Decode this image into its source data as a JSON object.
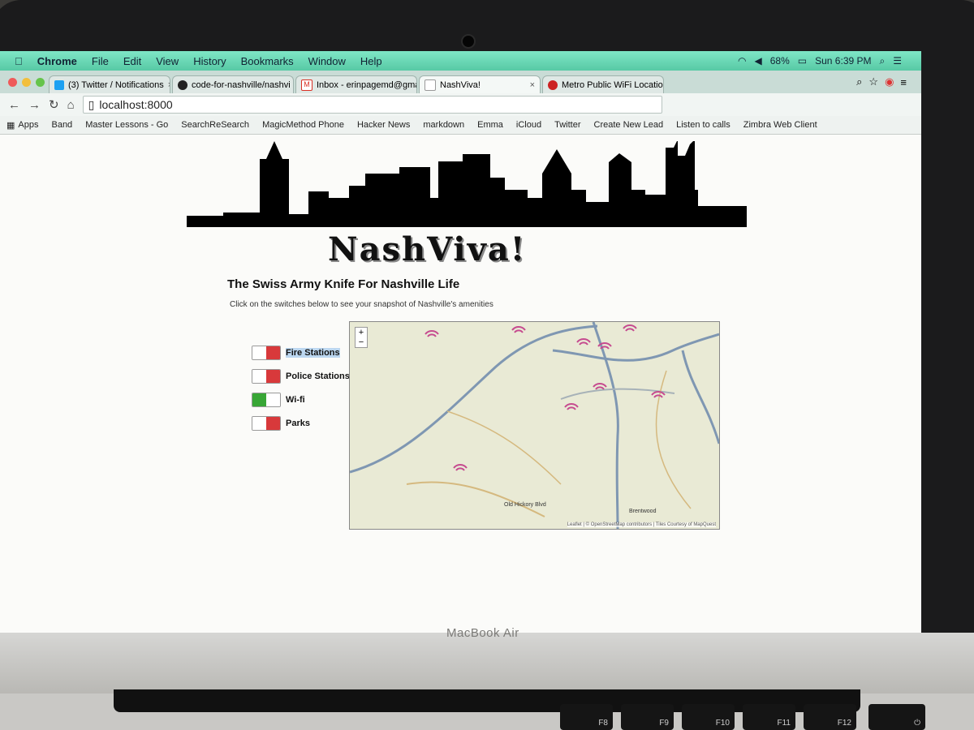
{
  "menubar": {
    "apple": "",
    "app": "Chrome",
    "items": [
      "File",
      "Edit",
      "View",
      "History",
      "Bookmarks",
      "Window",
      "Help"
    ],
    "battery": "68%",
    "clock": "Sun 6:39 PM"
  },
  "tabs": [
    {
      "title": "(3) Twitter / Notifications",
      "icon": "twitter-icon",
      "color": "#1da1f2"
    },
    {
      "title": "code-for-nashville/nashvi",
      "icon": "github-icon",
      "color": "#222222"
    },
    {
      "title": "Inbox - erinpagemd@gma",
      "icon": "gmail-icon",
      "color": "#d93025"
    },
    {
      "title": "NashViva!",
      "icon": "page-icon",
      "color": "#ffffff"
    },
    {
      "title": "Metro Public WiFi Location",
      "icon": "opera-icon",
      "color": "#cc2222"
    }
  ],
  "address": "localhost:8000",
  "bookmarks": [
    "Apps",
    "Band",
    "Master Lessons - Go",
    "SearchReSearch",
    "MagicMethod Phone",
    "Hacker News",
    "markdown",
    "Emma",
    "iCloud",
    "Twitter",
    "Create New Lead",
    "Listen to calls",
    "Zimbra Web Client"
  ],
  "page": {
    "title": "NashViva!",
    "subtitle": "The Swiss Army Knife For Nashville Life",
    "instructions": "Click on the switches below to see your snapshot of Nashville's amenities",
    "toggles": [
      {
        "label": "Fire Stations",
        "on": false
      },
      {
        "label": "Police Stations",
        "on": false
      },
      {
        "label": "Wi-fi",
        "on": true
      },
      {
        "label": "Parks",
        "on": false
      }
    ]
  },
  "map": {
    "zoom_in": "+",
    "zoom_out": "−",
    "attribution": "Leaflet | © OpenStreetMap contributors | Tiles Courtesy of MapQuest",
    "labels": [
      "Brentwood",
      "Old Hickory Blvd"
    ]
  },
  "device": {
    "brand": "MacBook Air",
    "keys": [
      "F8",
      "F9",
      "F10",
      "F11",
      "F12"
    ]
  },
  "colors": {
    "switch_off": "#d8393b",
    "switch_on": "#38a636",
    "wifi": "#c64b8f"
  }
}
